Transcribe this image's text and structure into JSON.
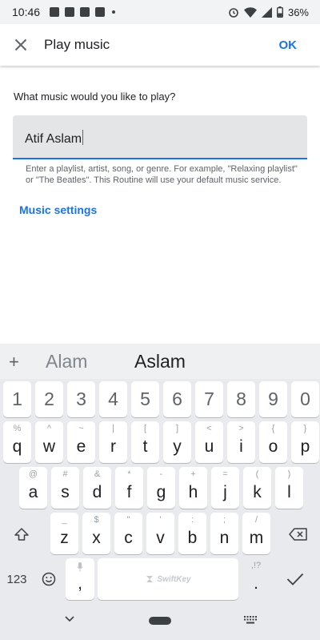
{
  "status_bar": {
    "time": "10:46",
    "left_icons": [
      "image-icon",
      "news-icon",
      "message-icon",
      "lightroom-icon"
    ],
    "battery": "36%"
  },
  "app_bar": {
    "title": "Play music",
    "ok_label": "OK"
  },
  "content": {
    "question": "What music would you like to play?",
    "input_value": "Atif Aslam",
    "helper_text": "Enter a playlist, artist, song, or genre. For example, \"Relaxing playlist\" or \"The Beatles\". This Routine will use your default music service.",
    "music_settings_link": "Music settings"
  },
  "keyboard": {
    "suggestion_plus": "+",
    "suggestions": [
      "Alam",
      "Aslam"
    ],
    "number_row": [
      "1",
      "2",
      "3",
      "4",
      "5",
      "6",
      "7",
      "8",
      "9",
      "0"
    ],
    "row1": [
      {
        "key": "q",
        "hint": "%"
      },
      {
        "key": "w",
        "hint": "^"
      },
      {
        "key": "e",
        "hint": "~"
      },
      {
        "key": "r",
        "hint": "|"
      },
      {
        "key": "t",
        "hint": "["
      },
      {
        "key": "y",
        "hint": "]"
      },
      {
        "key": "u",
        "hint": "<"
      },
      {
        "key": "i",
        "hint": ">"
      },
      {
        "key": "o",
        "hint": "{"
      },
      {
        "key": "p",
        "hint": "}"
      }
    ],
    "row2": [
      {
        "key": "a",
        "hint": "@"
      },
      {
        "key": "s",
        "hint": "#"
      },
      {
        "key": "d",
        "hint": "&"
      },
      {
        "key": "f",
        "hint": "*"
      },
      {
        "key": "g",
        "hint": "-"
      },
      {
        "key": "h",
        "hint": "+"
      },
      {
        "key": "j",
        "hint": "="
      },
      {
        "key": "k",
        "hint": "("
      },
      {
        "key": "l",
        "hint": ")"
      }
    ],
    "row3": [
      {
        "key": "z",
        "hint": "_"
      },
      {
        "key": "x",
        "hint": "$"
      },
      {
        "key": "c",
        "hint": "\""
      },
      {
        "key": "v",
        "hint": "'"
      },
      {
        "key": "b",
        "hint": ":"
      },
      {
        "key": "n",
        "hint": ";"
      },
      {
        "key": "m",
        "hint": "/"
      }
    ],
    "symbols_label": "123",
    "comma": ",",
    "period": ".",
    "period_hint": ",!?",
    "space_brand": "SwiftKey"
  }
}
